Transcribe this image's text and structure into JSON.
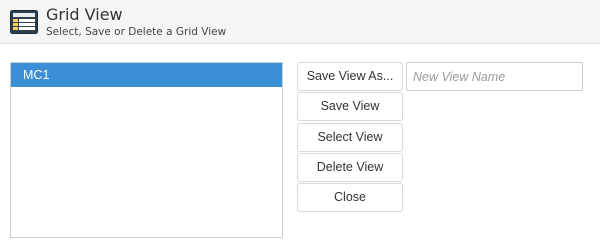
{
  "header": {
    "title": "Grid View",
    "subtitle": "Select, Save or Delete a Grid View",
    "icon": "grid-table-icon"
  },
  "views": {
    "items": [
      {
        "label": "MC1",
        "selected": true
      }
    ]
  },
  "buttons": {
    "save_as": "Save View As...",
    "save": "Save View",
    "select": "Select View",
    "delete": "Delete View",
    "close": "Close"
  },
  "new_view_name": {
    "value": "",
    "placeholder": "New View Name"
  },
  "colors": {
    "selected_bg": "#3b8fd4",
    "header_bg": "#f5f5f5"
  }
}
